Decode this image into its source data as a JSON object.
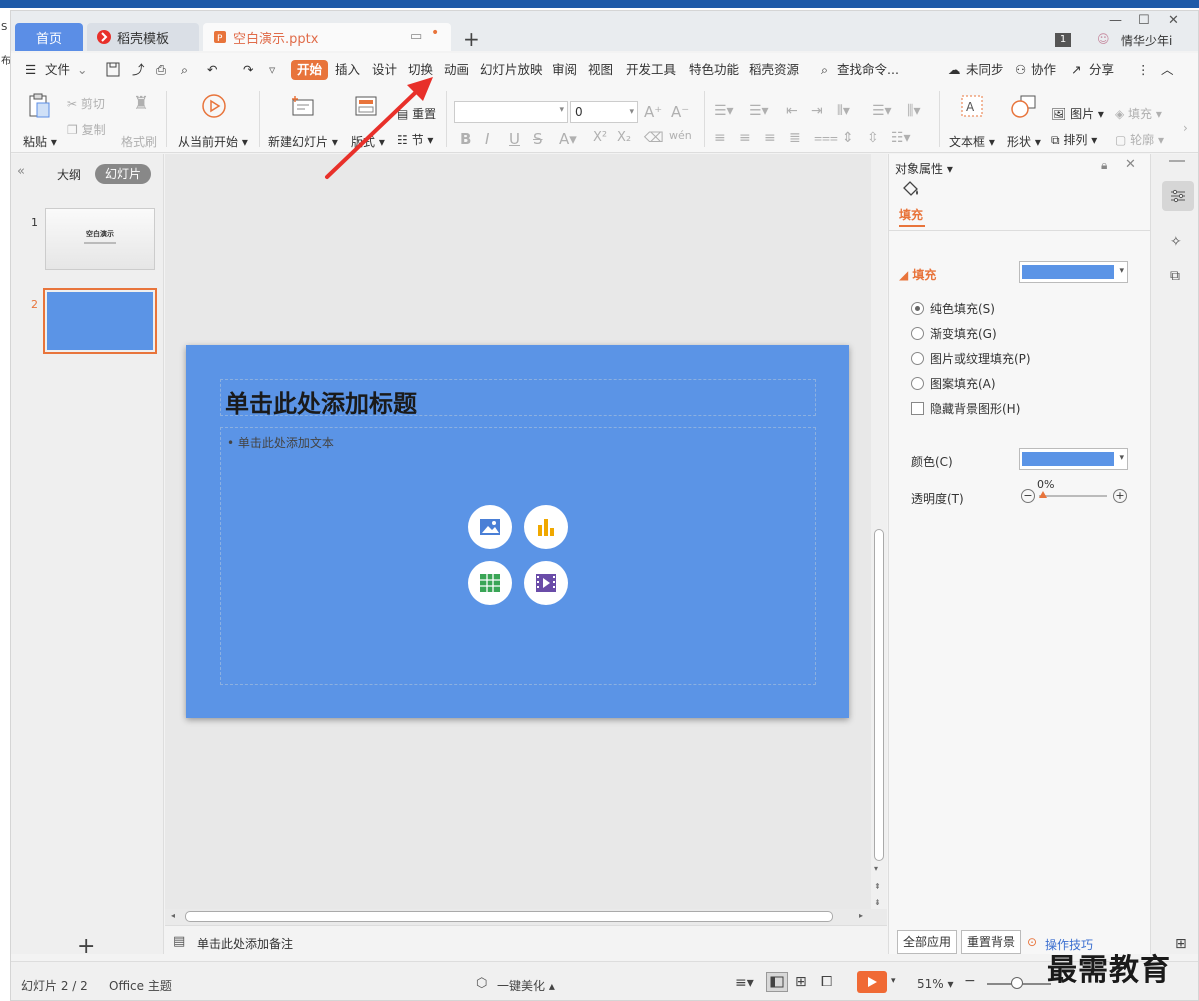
{
  "outside": {
    "left_glyph_1": "S",
    "left_glyph_2": "布"
  },
  "tabs": {
    "home": "首页",
    "template": "稻壳模板",
    "doc": "空白演示.pptx",
    "user_badge": "1",
    "user_name": "情华少年i"
  },
  "menu": {
    "file": "文件",
    "items": [
      "开始",
      "插入",
      "设计",
      "切换",
      "动画",
      "幻灯片放映",
      "审阅",
      "视图",
      "开发工具",
      "特色功能",
      "稻壳资源"
    ],
    "search": "查找命令...",
    "unsync": "未同步",
    "collab": "协作",
    "share": "分享"
  },
  "ribbon": {
    "paste": "粘贴",
    "cut": "剪切",
    "copy": "复制",
    "format_painter": "格式刷",
    "from_current": "从当前开始",
    "new_slide": "新建幻灯片",
    "layout": "版式",
    "reset": "重置",
    "section": "节",
    "font_size": "0",
    "textbox": "文本框",
    "shape": "形状",
    "picture": "图片",
    "arrange": "排列",
    "fill": "填充",
    "outline": "轮廓"
  },
  "left_panel": {
    "outline_tab": "大纲",
    "slides_tab": "幻灯片",
    "slide1_num": "1",
    "slide2_num": "2",
    "slide1_title": "空白演示",
    "add": "+"
  },
  "slide": {
    "title": "单击此处添加标题",
    "body": "单击此处添加文本"
  },
  "notes": {
    "placeholder": "单击此处添加备注"
  },
  "right_panel": {
    "title": "对象属性",
    "tab": "填充",
    "section": "填充",
    "options": [
      "纯色填充(S)",
      "渐变填充(G)",
      "图片或纹理填充(P)",
      "图案填充(A)"
    ],
    "hide_bg": "隐藏背景图形(H)",
    "color_label": "颜色(C)",
    "transparency_label": "透明度(T)",
    "transparency_value": "0%",
    "apply_all": "全部应用",
    "reset_bg": "重置背景",
    "tips": "操作技巧"
  },
  "status": {
    "slide_count": "幻灯片 2 / 2",
    "theme": "Office 主题",
    "beautify": "一键美化",
    "zoom": "51%"
  },
  "watermark": "最需教育",
  "colors": {
    "accent": "#e8743b",
    "slide_bg": "#5b94e6",
    "tab_blue": "#5b8ee6",
    "arrow": "#e8302a"
  }
}
